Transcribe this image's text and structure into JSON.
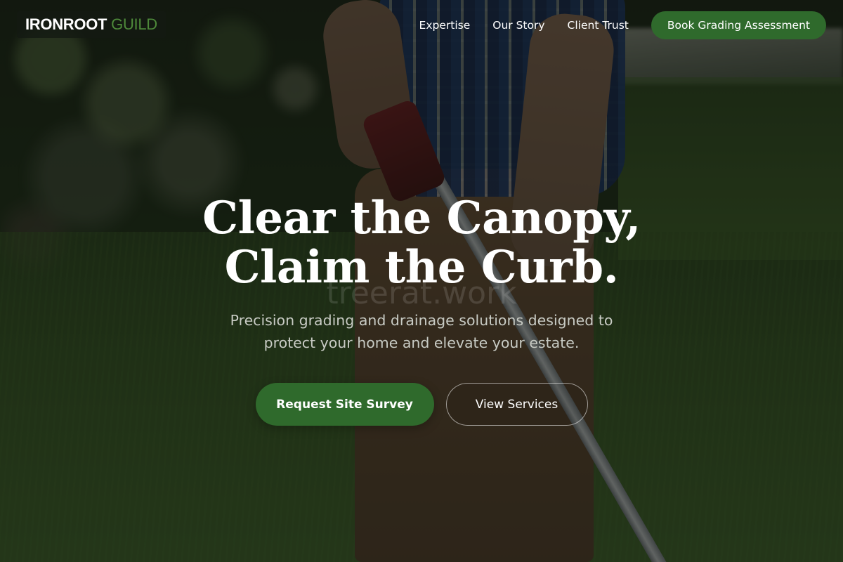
{
  "brand": {
    "name_part1": "IRONROOT",
    "name_part2": "GUILD"
  },
  "nav": {
    "links": [
      {
        "label": "Expertise"
      },
      {
        "label": "Our Story"
      },
      {
        "label": "Client Trust"
      }
    ],
    "cta_label": "Book Grading Assessment"
  },
  "hero": {
    "headline_line1": "Clear the Canopy,",
    "headline_line2": "Claim the Curb.",
    "watermark": "treerat.work",
    "subtitle": "Precision grading and drainage solutions designed to protect your home and elevate your estate.",
    "primary_cta": "Request Site Survey",
    "secondary_cta": "View Services"
  },
  "colors": {
    "accent_green": "#2f6a2c",
    "logo_green": "#4e8a3a",
    "text_white": "#ffffff"
  }
}
